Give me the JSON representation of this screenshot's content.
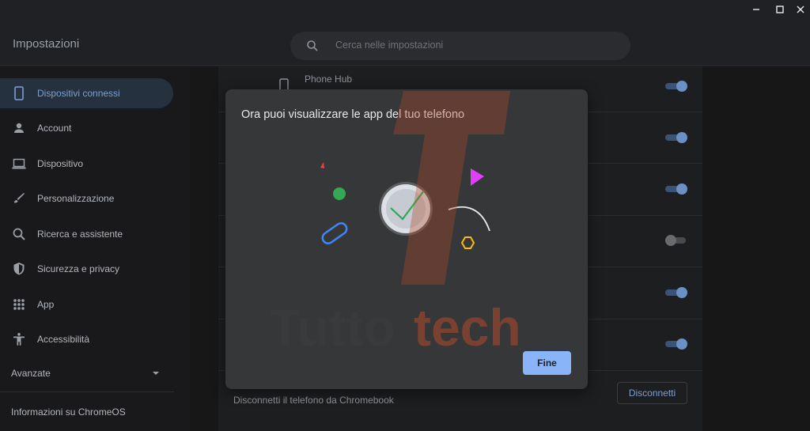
{
  "window": {
    "controls": [
      "minimize-icon",
      "maximize-icon",
      "close-icon"
    ]
  },
  "header": {
    "title": "Impostazioni",
    "search_placeholder": "Cerca nelle impostazioni"
  },
  "sidebar": {
    "items": [
      {
        "label": "Dispositivi connessi",
        "icon": "phone-icon",
        "active": true
      },
      {
        "label": "Account",
        "icon": "person-icon"
      },
      {
        "label": "Dispositivo",
        "icon": "laptop-icon"
      },
      {
        "label": "Personalizzazione",
        "icon": "brush-icon"
      },
      {
        "label": "Ricerca e assistente",
        "icon": "search-icon"
      },
      {
        "label": "Sicurezza e privacy",
        "icon": "shield-icon"
      },
      {
        "label": "App",
        "icon": "apps-grid-icon"
      },
      {
        "label": "Accessibilità",
        "icon": "accessibility-icon"
      }
    ],
    "advanced": "Avanzate",
    "about": "Informazioni su ChromeOS"
  },
  "main": {
    "phone_hub_label": "Phone Hub",
    "toggles": [
      true,
      true,
      true,
      false,
      true,
      true
    ],
    "disconnect_text": "Disconnetti il telefono da Chromebook",
    "disconnect_button": "Disconnetti"
  },
  "dialog": {
    "title": "Ora puoi visualizzare le app del tuo telefono",
    "done_button": "Fine"
  },
  "watermark": {
    "text_left": "Tutto",
    "text_right": "tech"
  },
  "colors": {
    "accent": "#8ab4f8",
    "dialog_bg": "#363739"
  }
}
